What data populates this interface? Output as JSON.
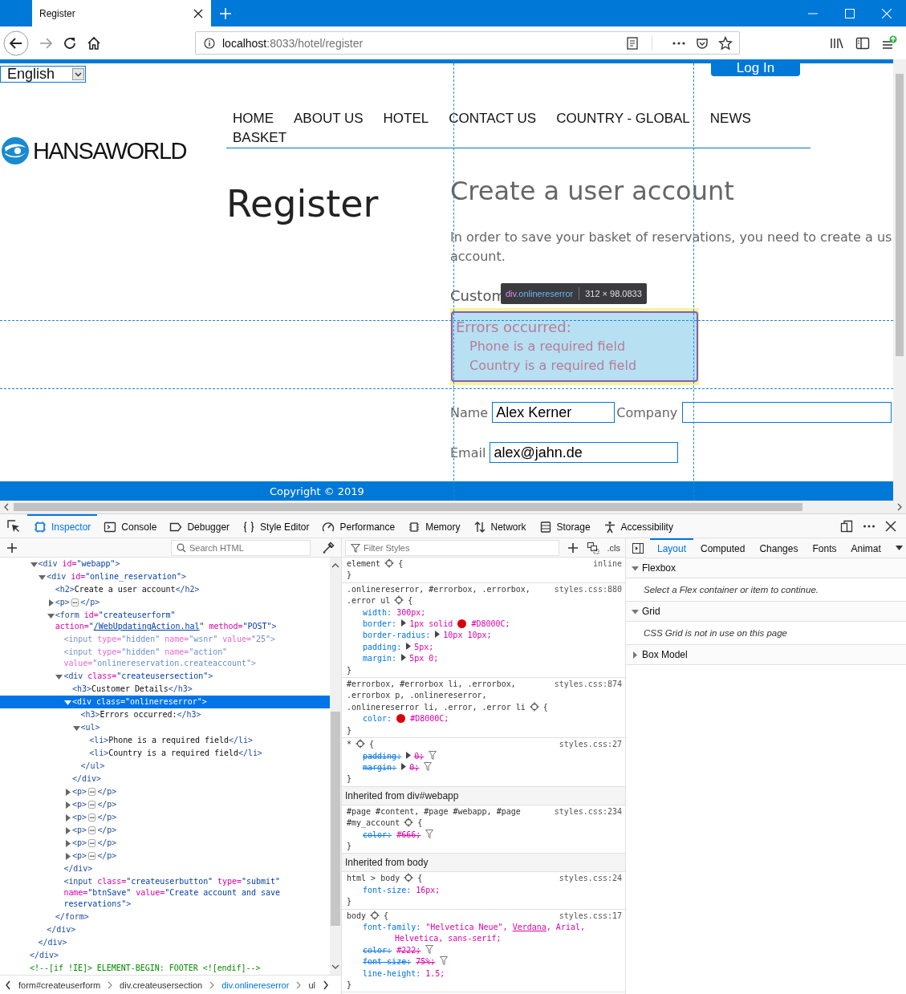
{
  "browser": {
    "tab_title": "Register",
    "url_host": "localhost",
    "url_rest": ":8033/hotel/register"
  },
  "page": {
    "language": "English",
    "login_button": "Log In",
    "logo_text": "HANSAWORLD",
    "nav": [
      {
        "label": "HOME"
      },
      {
        "label": "ABOUT US"
      },
      {
        "label": "HOTEL"
      },
      {
        "label": "CONTACT US"
      },
      {
        "label": "COUNTRY - GLOBAL"
      },
      {
        "label": "NEWS"
      },
      {
        "label": "BASKET"
      }
    ],
    "title": "Register",
    "heading": "Create a user account",
    "intro_lines": [
      "In order to save your basket of reservations, you need to create a us",
      "account."
    ],
    "section_heading": "Custom",
    "tooltip": {
      "tag": "div",
      "class": ".onlinereserror",
      "size": "312 × 98.0833"
    },
    "errors": {
      "title": "Errors occurred:",
      "items": [
        "Phone is a required field",
        "Country is a required field"
      ]
    },
    "fields": [
      {
        "label": "Name",
        "value": "Alex Kerner"
      },
      {
        "label": "Company"
      },
      {
        "label": "Email",
        "value": "alex@jahn.de"
      }
    ],
    "footer": "Copyright © 2019"
  },
  "devtools": {
    "tabs": [
      {
        "label": "Inspector",
        "selected": true
      },
      {
        "label": "Console",
        "selected": false
      },
      {
        "label": "Debugger",
        "selected": false
      },
      {
        "label": "Style Editor",
        "selected": false
      },
      {
        "label": "Performance",
        "selected": false
      },
      {
        "label": "Memory",
        "selected": false
      },
      {
        "label": "Network",
        "selected": false
      },
      {
        "label": "Storage",
        "selected": false
      },
      {
        "label": "Accessibility",
        "selected": false
      }
    ],
    "markup": {
      "search_placeholder": "Search HTML",
      "nodes": [
        {
          "children": [
            {
              "parts": [
                {
                  "kind": "tag",
                  "text": "<div"
                },
                {
                  "kind": "attr",
                  "text": " id="
                },
                {
                  "kind": "value",
                  "text": "\"webapp\""
                },
                {
                  "kind": "tag",
                  "text": ">"
                }
              ],
              "expanded": true,
              "selected": false,
              "children": [
                {
                  "parts": [
                    {
                      "kind": "tag",
                      "text": "<div"
                    },
                    {
                      "kind": "attr",
                      "text": " id="
                    },
                    {
                      "kind": "value",
                      "text": "\"online_reservation\""
                    },
                    {
                      "kind": "tag",
                      "text": ">"
                    }
                  ],
                  "expanded": true,
                  "selected": false,
                  "children": [
                    {
                      "parts": [
                        {
                          "kind": "tag",
                          "text": "<h2>"
                        },
                        {
                          "kind": "text",
                          "text": "Create a user account"
                        },
                        {
                          "kind": "tag",
                          "text": "</h2>"
                        }
                      ],
                      "selected": false
                    },
                    {
                      "parts": [
                        {
                          "kind": "tag",
                          "text": "<p>"
                        },
                        {
                          "kind": "more",
                          "text": "⋯"
                        },
                        {
                          "kind": "tag",
                          "text": "</p>"
                        }
                      ],
                      "expanded": false,
                      "selected": false
                    },
                    {
                      "parts": [
                        {
                          "kind": "tag",
                          "text": "<form"
                        },
                        {
                          "kind": "attr",
                          "text": " id="
                        },
                        {
                          "kind": "value",
                          "text": "\"createuserform\""
                        },
                        {
                          "kind": "attr",
                          "text": " action="
                        },
                        {
                          "kind": "value",
                          "text": "\""
                        },
                        {
                          "kind": "link",
                          "text": "/WebUpdatingAction.hal"
                        },
                        {
                          "kind": "value",
                          "text": "\""
                        },
                        {
                          "kind": "attr",
                          "text": " method="
                        },
                        {
                          "kind": "value",
                          "text": "\"POST\""
                        },
                        {
                          "kind": "tag",
                          "text": ">"
                        }
                      ],
                      "expanded": true,
                      "selected": false,
                      "children": [
                        {
                          "parts": [
                            {
                              "kind": "tag",
                              "text": "<input"
                            },
                            {
                              "kind": "attr",
                              "text": " type="
                            },
                            {
                              "kind": "value",
                              "text": "\"hidden\""
                            },
                            {
                              "kind": "attr",
                              "text": " name="
                            },
                            {
                              "kind": "value",
                              "text": "\"wsnr\""
                            },
                            {
                              "kind": "attr",
                              "text": " value="
                            },
                            {
                              "kind": "value",
                              "text": "\"25\""
                            },
                            {
                              "kind": "tag",
                              "text": ">"
                            }
                          ],
                          "dimmed": true,
                          "selected": false
                        },
                        {
                          "parts": [
                            {
                              "kind": "tag",
                              "text": "<input"
                            },
                            {
                              "kind": "attr",
                              "text": " type="
                            },
                            {
                              "kind": "value",
                              "text": "\"hidden\""
                            },
                            {
                              "kind": "attr",
                              "text": " name="
                            },
                            {
                              "kind": "value",
                              "text": "\"action\""
                            },
                            {
                              "kind": "attr",
                              "text": " value="
                            },
                            {
                              "kind": "value",
                              "text": "\"onlinereservation.createaccount\""
                            },
                            {
                              "kind": "tag",
                              "text": ">"
                            }
                          ],
                          "dimmed": true,
                          "selected": false
                        },
                        {
                          "parts": [
                            {
                              "kind": "tag",
                              "text": "<div"
                            },
                            {
                              "kind": "attr",
                              "text": " class="
                            },
                            {
                              "kind": "value",
                              "text": "\"createusersection\""
                            },
                            {
                              "kind": "tag",
                              "text": ">"
                            }
                          ],
                          "expanded": true,
                          "selected": false,
                          "children": [
                            {
                              "parts": [
                                {
                                  "kind": "tag",
                                  "text": "<h3>"
                                },
                                {
                                  "kind": "text",
                                  "text": "Customer Details"
                                },
                                {
                                  "kind": "tag",
                                  "text": "</h3>"
                                }
                              ],
                              "selected": false
                            },
                            {
                              "parts": [
                                {
                                  "kind": "tag",
                                  "text": "<div"
                                },
                                {
                                  "kind": "attr",
                                  "text": " class="
                                },
                                {
                                  "kind": "value",
                                  "text": "\"onlinereserror\""
                                },
                                {
                                  "kind": "tag",
                                  "text": ">"
                                }
                              ],
                              "expanded": true,
                              "selected": true,
                              "children": [
                                {
                                  "parts": [
                                    {
                                      "kind": "tag",
                                      "text": "<h3>"
                                    },
                                    {
                                      "kind": "text",
                                      "text": "Errors occurred:"
                                    },
                                    {
                                      "kind": "tag",
                                      "text": "</h3>"
                                    }
                                  ],
                                  "selected": false
                                },
                                {
                                  "parts": [
                                    {
                                      "kind": "tag",
                                      "text": "<ul>"
                                    }
                                  ],
                                  "expanded": true,
                                  "selected": false,
                                  "children": [
                                    {
                                      "parts": [
                                        {
                                          "kind": "tag",
                                          "text": "<li>"
                                        },
                                        {
                                          "kind": "text",
                                          "text": "Phone is a required field"
                                        },
                                        {
                                          "kind": "tag",
                                          "text": "</li>"
                                        }
                                      ],
                                      "selected": false
                                    },
                                    {
                                      "parts": [
                                        {
                                          "kind": "tag",
                                          "text": "<li>"
                                        },
                                        {
                                          "kind": "text",
                                          "text": "Country is a required field"
                                        },
                                        {
                                          "kind": "tag",
                                          "text": "</li>"
                                        }
                                      ],
                                      "selected": false
                                    }
                                  ]
                                },
                                {
                                  "parts": [
                                    {
                                      "kind": "tag",
                                      "text": "</ul>"
                                    }
                                  ],
                                  "selected": false
                                }
                              ]
                            },
                            {
                              "parts": [
                                {
                                  "kind": "tag",
                                  "text": "</div>"
                                }
                              ],
                              "selected": false
                            },
                            {
                              "parts": [
                                {
                                  "kind": "tag",
                                  "text": "<p>"
                                },
                                {
                                  "kind": "more",
                                  "text": "⋯"
                                },
                                {
                                  "kind": "tag",
                                  "text": "</p>"
                                }
                              ],
                              "expanded": false,
                              "selected": false
                            },
                            {
                              "parts": [
                                {
                                  "kind": "tag",
                                  "text": "<p>"
                                },
                                {
                                  "kind": "more",
                                  "text": "⋯"
                                },
                                {
                                  "kind": "tag",
                                  "text": "</p>"
                                }
                              ],
                              "expanded": false,
                              "selected": false
                            },
                            {
                              "parts": [
                                {
                                  "kind": "tag",
                                  "text": "<p>"
                                },
                                {
                                  "kind": "more",
                                  "text": "⋯"
                                },
                                {
                                  "kind": "tag",
                                  "text": "</p>"
                                }
                              ],
                              "expanded": false,
                              "selected": false
                            },
                            {
                              "parts": [
                                {
                                  "kind": "tag",
                                  "text": "<p>"
                                },
                                {
                                  "kind": "more",
                                  "text": "⋯"
                                },
                                {
                                  "kind": "tag",
                                  "text": "</p>"
                                }
                              ],
                              "expanded": false,
                              "selected": false
                            },
                            {
                              "parts": [
                                {
                                  "kind": "tag",
                                  "text": "<p>"
                                },
                                {
                                  "kind": "more",
                                  "text": "⋯"
                                },
                                {
                                  "kind": "tag",
                                  "text": "</p>"
                                }
                              ],
                              "expanded": false,
                              "selected": false
                            },
                            {
                              "parts": [
                                {
                                  "kind": "tag",
                                  "text": "<p>"
                                },
                                {
                                  "kind": "more",
                                  "text": "⋯"
                                },
                                {
                                  "kind": "tag",
                                  "text": "</p>"
                                }
                              ],
                              "expanded": false,
                              "selected": false
                            }
                          ]
                        },
                        {
                          "parts": [
                            {
                              "kind": "tag",
                              "text": "</div>"
                            }
                          ],
                          "selected": false
                        },
                        {
                          "parts": [
                            {
                              "kind": "tag",
                              "text": "<input"
                            },
                            {
                              "kind": "attr",
                              "text": " class="
                            },
                            {
                              "kind": "value",
                              "text": "\"createuserbutton\""
                            },
                            {
                              "kind": "attr",
                              "text": " type="
                            },
                            {
                              "kind": "value",
                              "text": "\"submit\""
                            },
                            {
                              "kind": "attr",
                              "text": " name="
                            },
                            {
                              "kind": "value",
                              "text": "\"btnSave\""
                            },
                            {
                              "kind": "attr",
                              "text": " value="
                            },
                            {
                              "kind": "value",
                              "text": "\"Create account and save reservations\""
                            },
                            {
                              "kind": "tag",
                              "text": ">"
                            }
                          ],
                          "selected": false
                        }
                      ]
                    },
                    {
                      "parts": [
                        {
                          "kind": "tag",
                          "text": "</form>"
                        }
                      ],
                      "selected": false
                    }
                  ]
                },
                {
                  "parts": [
                    {
                      "kind": "tag",
                      "text": "</div>"
                    }
                  ],
                  "selected": false
                }
              ]
            },
            {
              "parts": [
                {
                  "kind": "tag",
                  "text": "</div>"
                }
              ],
              "selected": false
            }
          ]
        },
        {
          "parts": [
            {
              "kind": "tag",
              "text": "</div>"
            }
          ],
          "selected": false
        },
        {
          "parts": [
            {
              "kind": "comment",
              "text": "<!--[if !IE]> ELEMENT-BEGIN: FOOTER <![endif]-->"
            }
          ],
          "selected": false
        }
      ]
    },
    "breadcrumbs": [
      {
        "label": "form#createuserform",
        "selected": false
      },
      {
        "label": "div.createusersection",
        "selected": false
      },
      {
        "label": "div.onlinereserror",
        "selected": true
      },
      {
        "label": "ul",
        "selected": false
      }
    ],
    "rules": {
      "filter_placeholder": "Filter Styles",
      "cls_label": ".cls",
      "blocks": [
        {
          "kind": "rule",
          "selector_lines": [
            "element"
          ],
          "brace_open": "{",
          "brace_close": "}",
          "source": "inline"
        },
        {
          "kind": "rule",
          "selector_lines": [
            ".onlinereserror, #errorbox, .errorbox,",
            ".error ul"
          ],
          "brace_open": "{",
          "brace_close": "}",
          "source": "styles.css:880",
          "declarations": [
            {
              "name": "width:",
              "expandable": false,
              "overridden": false,
              "value": [
                {
                  "kind": "text",
                  "text": "300px;"
                }
              ]
            },
            {
              "name": "border:",
              "expandable": true,
              "overridden": false,
              "value": [
                {
                  "kind": "text",
                  "text": "1px solid"
                },
                {
                  "kind": "swatch",
                  "color": "#d8000c"
                },
                {
                  "kind": "text",
                  "text": "#D8000C;"
                }
              ]
            },
            {
              "name": "border-radius:",
              "expandable": true,
              "overridden": false,
              "value": [
                {
                  "kind": "text",
                  "text": "10px 10px;"
                }
              ]
            },
            {
              "name": "padding:",
              "expandable": true,
              "overridden": false,
              "value": [
                {
                  "kind": "text",
                  "text": "5px;"
                }
              ]
            },
            {
              "name": "margin:",
              "expandable": true,
              "overridden": false,
              "value": [
                {
                  "kind": "text",
                  "text": "5px 0;"
                }
              ]
            }
          ]
        },
        {
          "kind": "rule",
          "selector_lines": [
            "#errorbox, #errorbox li, .errorbox,",
            ".errorbox p, .onlinereserror,",
            ".onlinereserror li, .error, .error li"
          ],
          "brace_open": "{",
          "brace_close": "}",
          "source": "styles.css:874",
          "declarations": [
            {
              "name": "color:",
              "expandable": false,
              "overridden": false,
              "value": [
                {
                  "kind": "swatch",
                  "color": "#d8000c"
                },
                {
                  "kind": "text",
                  "text": "#D8000C;"
                }
              ]
            }
          ]
        },
        {
          "kind": "rule",
          "selector_lines": [
            "*"
          ],
          "brace_open": "{",
          "brace_close": "}",
          "source": "styles.css:27",
          "declarations": [
            {
              "name": "padding:",
              "expandable": true,
              "overridden": true,
              "value": [
                {
                  "kind": "text",
                  "text": "0;"
                }
              ]
            },
            {
              "name": "margin:",
              "expandable": true,
              "overridden": true,
              "value": [
                {
                  "kind": "text",
                  "text": "0;"
                }
              ]
            }
          ]
        },
        {
          "kind": "header",
          "text": "Inherited from div#webapp"
        },
        {
          "kind": "rule",
          "selector_lines": [
            "#page #content, #page #webapp, #page",
            "#my_account"
          ],
          "brace_open": "{",
          "brace_close": "}",
          "source": "styles.css:234",
          "declarations": [
            {
              "name": "color:",
              "expandable": false,
              "overridden": true,
              "value": [
                {
                  "kind": "text",
                  "text": "#666;"
                }
              ]
            }
          ]
        },
        {
          "kind": "header",
          "text": "Inherited from body"
        },
        {
          "kind": "rule",
          "selector_lines": [
            "html > body"
          ],
          "brace_open": "{",
          "brace_close": "}",
          "source": "styles.css:24",
          "declarations": [
            {
              "name": "font-size:",
              "expandable": false,
              "overridden": false,
              "value": [
                {
                  "kind": "text",
                  "text": "16px;"
                }
              ]
            }
          ]
        },
        {
          "kind": "rule",
          "selector_lines": [
            "body"
          ],
          "brace_open": "{",
          "brace_close": "}",
          "source": "styles.css:17",
          "declarations": [
            {
              "name": "font-family:",
              "expandable": false,
              "overridden": false,
              "value": [
                {
                  "kind": "text",
                  "text": "\"Helvetica Neue\","
                },
                {
                  "kind": "link",
                  "text": "Verdana"
                },
                {
                  "kind": "text",
                  "text": ", Arial,"
                },
                {
                  "kind": "text",
                  "text": "Helvetica, sans-serif;"
                }
              ]
            },
            {
              "name": "color:",
              "expandable": false,
              "overridden": true,
              "value": [
                {
                  "kind": "text",
                  "text": "#222;"
                }
              ]
            },
            {
              "name": "font-size:",
              "expandable": false,
              "overridden": true,
              "value": [
                {
                  "kind": "text",
                  "text": "75%;"
                }
              ]
            },
            {
              "name": "line-height:",
              "expandable": false,
              "overridden": false,
              "value": [
                {
                  "kind": "text",
                  "text": "1.5;"
                }
              ]
            }
          ]
        }
      ]
    },
    "layout": {
      "tabs": [
        {
          "label": "Layout",
          "selected": true
        },
        {
          "label": "Computed",
          "selected": false
        },
        {
          "label": "Changes",
          "selected": false
        },
        {
          "label": "Fonts",
          "selected": false
        },
        {
          "label": "Animat",
          "selected": false
        }
      ],
      "sections": [
        {
          "title": "Flexbox",
          "expanded": true,
          "message": "Select a Flex container or item to continue."
        },
        {
          "title": "Grid",
          "expanded": true,
          "message": "CSS Grid is not in use on this page"
        },
        {
          "title": "Box Model",
          "expanded": false
        }
      ]
    }
  }
}
